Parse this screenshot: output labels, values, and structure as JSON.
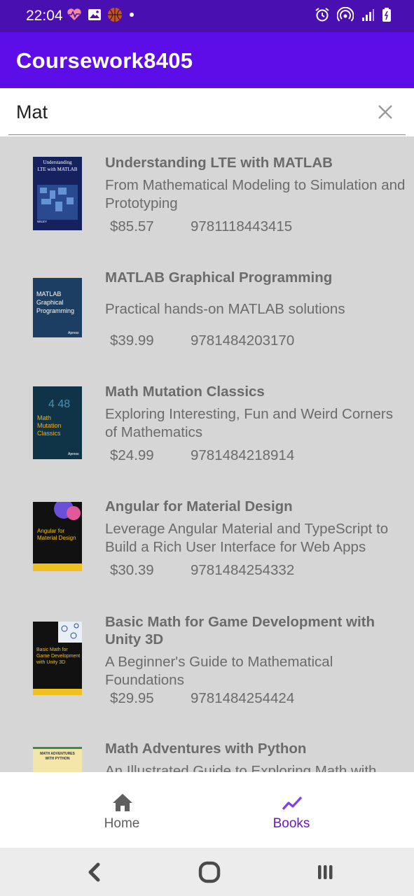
{
  "status_bar": {
    "time": "22:04",
    "left_icons": [
      "heart-rate-icon",
      "gallery-icon",
      "basketball-icon",
      "dot-icon"
    ],
    "right_icons": [
      "alarm-icon",
      "hotspot-icon",
      "signal-icon",
      "battery-icon"
    ]
  },
  "app_bar": {
    "title": "Coursework8405"
  },
  "search": {
    "value": "Mat",
    "clear_icon": "close-icon"
  },
  "books": [
    {
      "title": "Understanding LTE with MATLAB",
      "subtitle": "From Mathematical Modeling to Simulation and Prototyping",
      "price": "$85.57",
      "isbn": "9781118443415",
      "cover": {
        "text": "Understanding LTE with MATLAB",
        "publisher": "WILEY"
      }
    },
    {
      "title": "MATLAB Graphical Programming",
      "subtitle": "Practical hands-on MATLAB solutions",
      "price": "$39.99",
      "isbn": "9781484203170",
      "cover": {
        "text": "MATLAB Graphical Programming",
        "publisher": "Apress"
      }
    },
    {
      "title": "Math Mutation Classics",
      "subtitle": "Exploring Interesting, Fun and Weird Corners of Mathematics",
      "price": "$24.99",
      "isbn": "9781484218914",
      "cover": {
        "text": "Math Mutation Classics",
        "publisher": "Apress"
      }
    },
    {
      "title": "Angular for Material Design",
      "subtitle": "Leverage Angular Material and TypeScript to Build a Rich User Interface for Web Apps",
      "price": "$30.39",
      "isbn": "9781484254332",
      "cover": {
        "text": "Angular for Material Design",
        "publisher": "Apress"
      }
    },
    {
      "title": "Basic Math for Game Development with Unity 3D",
      "subtitle": "A Beginner's Guide to Mathematical Foundations",
      "price": "$29.95",
      "isbn": "9781484254424",
      "cover": {
        "text": "Basic Math for Game Development with Unity 3D",
        "publisher": "Apress"
      }
    },
    {
      "title": "Math Adventures with Python",
      "subtitle": "An Illustrated Guide to Exploring Math with",
      "price": "",
      "isbn": "",
      "cover": {
        "text": "MATH ADVENTURES WITH PYTHON",
        "publisher": ""
      }
    }
  ],
  "bottom_nav": {
    "items": [
      {
        "label": "Home",
        "icon": "home-icon",
        "color": "#5f5f5f"
      },
      {
        "label": "Books",
        "icon": "trending-up-icon",
        "color": "#6a1bb5"
      }
    ]
  },
  "system_nav": {
    "buttons": [
      "back-icon",
      "home-button-icon",
      "recents-icon"
    ]
  },
  "colors": {
    "status_bar": "#4a0fb0",
    "app_bar": "#5d0ee8",
    "list_background": "#d6d6d6",
    "accent": "#6a1bb5"
  }
}
